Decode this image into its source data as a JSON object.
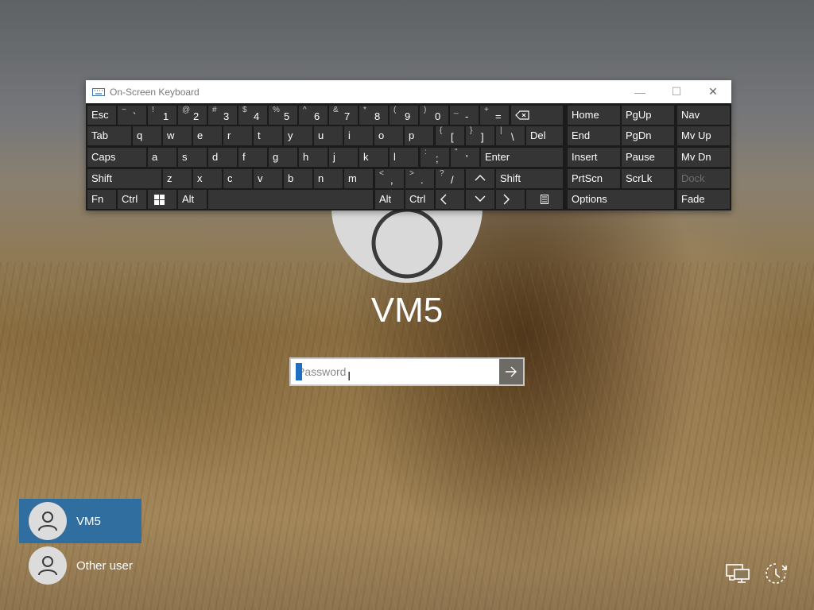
{
  "login": {
    "username": "VM5",
    "password_placeholder": "Password"
  },
  "users": [
    {
      "name": "VM5",
      "selected": true
    },
    {
      "name": "Other user",
      "selected": false
    }
  ],
  "osk": {
    "title": "On-Screen Keyboard",
    "keys": {
      "esc": "Esc",
      "tab": "Tab",
      "caps": "Caps",
      "shift_left": "Shift",
      "fn": "Fn",
      "ctrl_left": "Ctrl",
      "alt_left": "Alt",
      "alt_right": "Alt",
      "ctrl_right": "Ctrl",
      "del": "Del",
      "enter": "Enter",
      "shift_right": "Shift",
      "home": "Home",
      "pgup": "PgUp",
      "nav": "Nav",
      "end": "End",
      "pgdn": "PgDn",
      "mvup": "Mv Up",
      "insert": "Insert",
      "pause": "Pause",
      "mvdn": "Mv Dn",
      "prtscn": "PrtScn",
      "scrlk": "ScrLk",
      "dock": "Dock",
      "options": "Options",
      "fade": "Fade"
    },
    "number_row": [
      {
        "shift": "~",
        "key": "`"
      },
      {
        "shift": "!",
        "key": "1"
      },
      {
        "shift": "@",
        "key": "2"
      },
      {
        "shift": "#",
        "key": "3"
      },
      {
        "shift": "$",
        "key": "4"
      },
      {
        "shift": "%",
        "key": "5"
      },
      {
        "shift": "^",
        "key": "6"
      },
      {
        "shift": "&",
        "key": "7"
      },
      {
        "shift": "*",
        "key": "8"
      },
      {
        "shift": "(",
        "key": "9"
      },
      {
        "shift": ")",
        "key": "0"
      },
      {
        "shift": "_",
        "key": "-"
      },
      {
        "shift": "+",
        "key": "="
      }
    ],
    "row_q": [
      "q",
      "w",
      "e",
      "r",
      "t",
      "y",
      "u",
      "i",
      "o",
      "p"
    ],
    "row_q_sym": [
      {
        "shift": "{",
        "key": "["
      },
      {
        "shift": "}",
        "key": "]"
      },
      {
        "shift": "|",
        "key": "\\"
      }
    ],
    "row_a": [
      "a",
      "s",
      "d",
      "f",
      "g",
      "h",
      "j",
      "k",
      "l"
    ],
    "row_a_sym": [
      {
        "shift": ":",
        "key": ";"
      },
      {
        "shift": "\"",
        "key": "'"
      }
    ],
    "row_z": [
      "z",
      "x",
      "c",
      "v",
      "b",
      "n",
      "m"
    ],
    "row_z_sym": [
      {
        "shift": "<",
        "key": ","
      },
      {
        "shift": ">",
        "key": "."
      },
      {
        "shift": "?",
        "key": "/"
      }
    ]
  },
  "icons": {
    "keyboard": "keyboard-icon",
    "backspace": "backspace-icon",
    "windows": "windows-logo-icon",
    "arrow_up": "arrow-up-icon",
    "arrow_down": "arrow-down-icon",
    "arrow_left": "arrow-left-icon",
    "arrow_right": "arrow-right-icon",
    "menu": "context-menu-icon",
    "submit": "arrow-right-icon",
    "network": "network-icon",
    "power": "power-icon"
  },
  "colors": {
    "selected_user": "#2f6e9f",
    "key_bg": "#353535",
    "osk_bg": "#1b1b1b",
    "caret": "#1e6fc4"
  }
}
